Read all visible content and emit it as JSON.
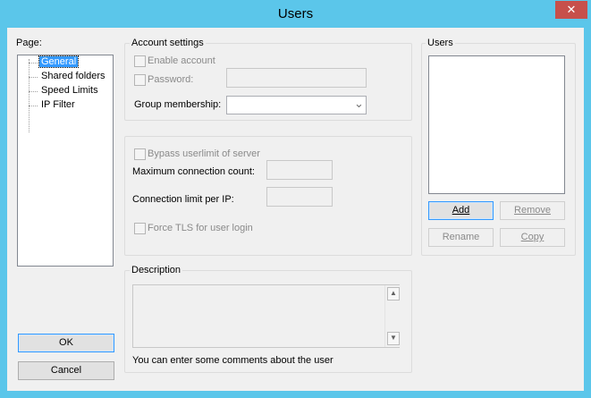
{
  "window": {
    "title": "Users",
    "close_glyph": "✕"
  },
  "page_panel": {
    "label": "Page:",
    "items": [
      "General",
      "Shared folders",
      "Speed Limits",
      "IP Filter"
    ]
  },
  "account": {
    "title": "Account settings",
    "enable_account": "Enable account",
    "password": "Password:",
    "group_membership": "Group membership:",
    "group_value": ""
  },
  "limits": {
    "bypass": "Bypass userlimit of server",
    "max_conn": "Maximum connection count:",
    "conn_per_ip": "Connection limit per IP:",
    "force_tls": "Force TLS for user login"
  },
  "description": {
    "title": "Description",
    "hint": "You can enter some comments about the user"
  },
  "users": {
    "title": "Users",
    "add": "Add",
    "remove": "Remove",
    "rename": "Rename",
    "copy": "Copy"
  },
  "buttons": {
    "ok": "OK",
    "cancel": "Cancel"
  },
  "icons": {
    "chevron_down": "⌄",
    "scroll_up": "▲",
    "scroll_down": "▼"
  }
}
